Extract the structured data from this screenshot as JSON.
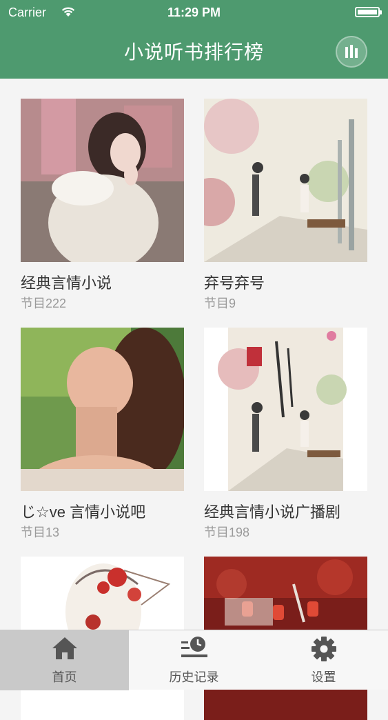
{
  "status_bar": {
    "carrier": "Carrier",
    "time": "11:29 PM"
  },
  "header": {
    "title": "小说听书排行榜",
    "right_icon": "now-playing-bars-icon"
  },
  "colors": {
    "header_bg": "#4e9a6f",
    "tab_active_bg": "#c9c9c9"
  },
  "programs": [
    {
      "title": "经典言情小说",
      "count": "节目222",
      "cover": "girl-in-white-sweater-photo"
    },
    {
      "title": "弃号弃号",
      "count": "节目9",
      "cover": "illustrated-couple-park-scene"
    },
    {
      "title": "じ☆ve 言情小说吧",
      "count": "节目13",
      "cover": "girl-smiling-green-background-photo"
    },
    {
      "title": "经典言情小说广播剧",
      "count": "节目198",
      "cover": "illustrated-book-cover-couple"
    },
    {
      "title": "",
      "count": "",
      "cover": "illustrated-girl-red-flowers"
    },
    {
      "title": "",
      "count": "",
      "cover": "red-lanterns-illustration"
    }
  ],
  "tabs": [
    {
      "label": "首页",
      "icon": "home-icon",
      "active": true
    },
    {
      "label": "历史记录",
      "icon": "history-icon",
      "active": false
    },
    {
      "label": "设置",
      "icon": "gear-icon",
      "active": false
    }
  ]
}
